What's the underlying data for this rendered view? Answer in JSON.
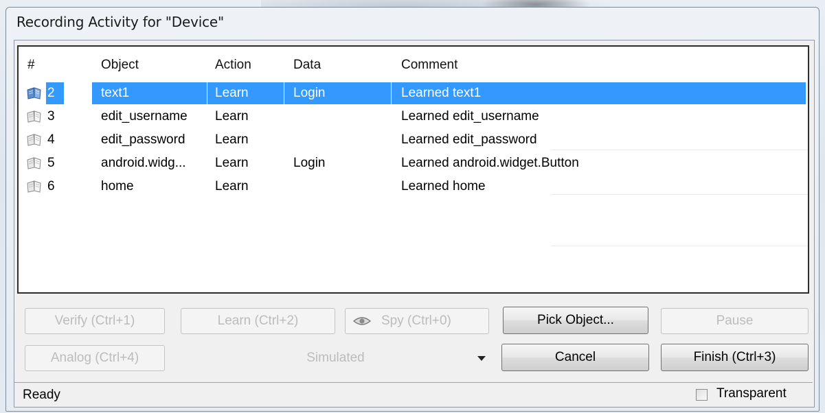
{
  "window": {
    "title": "Recording Activity for \"Device\""
  },
  "list": {
    "columns": [
      "#",
      "Object",
      "Action",
      "Data",
      "Comment"
    ],
    "rows": [
      {
        "num": "2",
        "object": "text1",
        "action": "Learn",
        "data": "Login",
        "comment": "Learned text1",
        "selected": true
      },
      {
        "num": "3",
        "object": "edit_username",
        "action": "Learn",
        "data": "",
        "comment": "Learned edit_username",
        "selected": false
      },
      {
        "num": "4",
        "object": "edit_password",
        "action": "Learn",
        "data": "",
        "comment": "Learned edit_password",
        "selected": false
      },
      {
        "num": "5",
        "object": "android.widg...",
        "action": "Learn",
        "data": "Login",
        "comment": "Learned android.widget.Button",
        "selected": false
      },
      {
        "num": "6",
        "object": "home",
        "action": "Learn",
        "data": "",
        "comment": "Learned home",
        "selected": false
      }
    ],
    "row_icon": "book-icon"
  },
  "buttons": {
    "verify": "Verify (Ctrl+1)",
    "learn": "Learn (Ctrl+2)",
    "spy": "Spy (Ctrl+0)",
    "pick_object": "Pick Object...",
    "pause": "Pause",
    "analog": "Analog (Ctrl+4)",
    "cancel": "Cancel",
    "finish": "Finish (Ctrl+3)"
  },
  "combo": {
    "value": "Simulated"
  },
  "status": {
    "text": "Ready"
  },
  "transparent": {
    "label": "Transparent",
    "checked": false
  },
  "colors": {
    "selection": "#3399ff",
    "disabled_text": "#bcbcbc"
  }
}
